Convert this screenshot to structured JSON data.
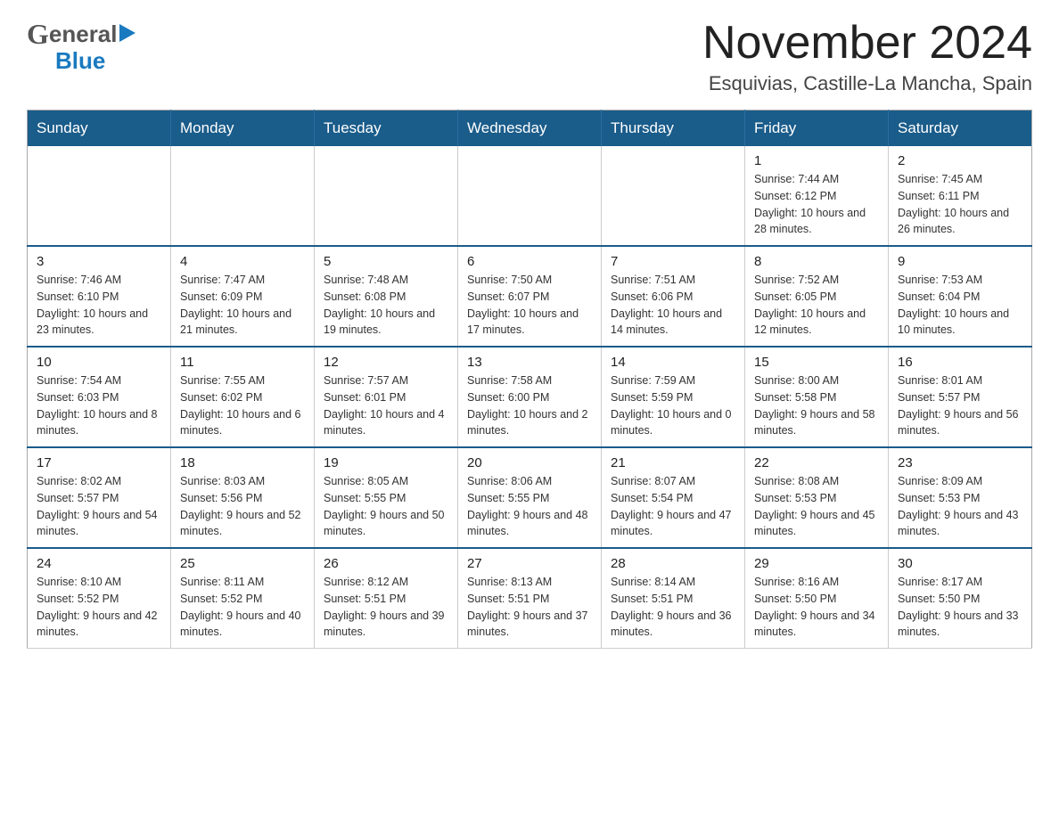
{
  "header": {
    "logo_general": "General",
    "logo_blue": "Blue",
    "month_title": "November 2024",
    "location": "Esquivias, Castille-La Mancha, Spain"
  },
  "days_of_week": [
    "Sunday",
    "Monday",
    "Tuesday",
    "Wednesday",
    "Thursday",
    "Friday",
    "Saturday"
  ],
  "weeks": [
    [
      {
        "day": "",
        "info": ""
      },
      {
        "day": "",
        "info": ""
      },
      {
        "day": "",
        "info": ""
      },
      {
        "day": "",
        "info": ""
      },
      {
        "day": "",
        "info": ""
      },
      {
        "day": "1",
        "info": "Sunrise: 7:44 AM\nSunset: 6:12 PM\nDaylight: 10 hours and 28 minutes."
      },
      {
        "day": "2",
        "info": "Sunrise: 7:45 AM\nSunset: 6:11 PM\nDaylight: 10 hours and 26 minutes."
      }
    ],
    [
      {
        "day": "3",
        "info": "Sunrise: 7:46 AM\nSunset: 6:10 PM\nDaylight: 10 hours and 23 minutes."
      },
      {
        "day": "4",
        "info": "Sunrise: 7:47 AM\nSunset: 6:09 PM\nDaylight: 10 hours and 21 minutes."
      },
      {
        "day": "5",
        "info": "Sunrise: 7:48 AM\nSunset: 6:08 PM\nDaylight: 10 hours and 19 minutes."
      },
      {
        "day": "6",
        "info": "Sunrise: 7:50 AM\nSunset: 6:07 PM\nDaylight: 10 hours and 17 minutes."
      },
      {
        "day": "7",
        "info": "Sunrise: 7:51 AM\nSunset: 6:06 PM\nDaylight: 10 hours and 14 minutes."
      },
      {
        "day": "8",
        "info": "Sunrise: 7:52 AM\nSunset: 6:05 PM\nDaylight: 10 hours and 12 minutes."
      },
      {
        "day": "9",
        "info": "Sunrise: 7:53 AM\nSunset: 6:04 PM\nDaylight: 10 hours and 10 minutes."
      }
    ],
    [
      {
        "day": "10",
        "info": "Sunrise: 7:54 AM\nSunset: 6:03 PM\nDaylight: 10 hours and 8 minutes."
      },
      {
        "day": "11",
        "info": "Sunrise: 7:55 AM\nSunset: 6:02 PM\nDaylight: 10 hours and 6 minutes."
      },
      {
        "day": "12",
        "info": "Sunrise: 7:57 AM\nSunset: 6:01 PM\nDaylight: 10 hours and 4 minutes."
      },
      {
        "day": "13",
        "info": "Sunrise: 7:58 AM\nSunset: 6:00 PM\nDaylight: 10 hours and 2 minutes."
      },
      {
        "day": "14",
        "info": "Sunrise: 7:59 AM\nSunset: 5:59 PM\nDaylight: 10 hours and 0 minutes."
      },
      {
        "day": "15",
        "info": "Sunrise: 8:00 AM\nSunset: 5:58 PM\nDaylight: 9 hours and 58 minutes."
      },
      {
        "day": "16",
        "info": "Sunrise: 8:01 AM\nSunset: 5:57 PM\nDaylight: 9 hours and 56 minutes."
      }
    ],
    [
      {
        "day": "17",
        "info": "Sunrise: 8:02 AM\nSunset: 5:57 PM\nDaylight: 9 hours and 54 minutes."
      },
      {
        "day": "18",
        "info": "Sunrise: 8:03 AM\nSunset: 5:56 PM\nDaylight: 9 hours and 52 minutes."
      },
      {
        "day": "19",
        "info": "Sunrise: 8:05 AM\nSunset: 5:55 PM\nDaylight: 9 hours and 50 minutes."
      },
      {
        "day": "20",
        "info": "Sunrise: 8:06 AM\nSunset: 5:55 PM\nDaylight: 9 hours and 48 minutes."
      },
      {
        "day": "21",
        "info": "Sunrise: 8:07 AM\nSunset: 5:54 PM\nDaylight: 9 hours and 47 minutes."
      },
      {
        "day": "22",
        "info": "Sunrise: 8:08 AM\nSunset: 5:53 PM\nDaylight: 9 hours and 45 minutes."
      },
      {
        "day": "23",
        "info": "Sunrise: 8:09 AM\nSunset: 5:53 PM\nDaylight: 9 hours and 43 minutes."
      }
    ],
    [
      {
        "day": "24",
        "info": "Sunrise: 8:10 AM\nSunset: 5:52 PM\nDaylight: 9 hours and 42 minutes."
      },
      {
        "day": "25",
        "info": "Sunrise: 8:11 AM\nSunset: 5:52 PM\nDaylight: 9 hours and 40 minutes."
      },
      {
        "day": "26",
        "info": "Sunrise: 8:12 AM\nSunset: 5:51 PM\nDaylight: 9 hours and 39 minutes."
      },
      {
        "day": "27",
        "info": "Sunrise: 8:13 AM\nSunset: 5:51 PM\nDaylight: 9 hours and 37 minutes."
      },
      {
        "day": "28",
        "info": "Sunrise: 8:14 AM\nSunset: 5:51 PM\nDaylight: 9 hours and 36 minutes."
      },
      {
        "day": "29",
        "info": "Sunrise: 8:16 AM\nSunset: 5:50 PM\nDaylight: 9 hours and 34 minutes."
      },
      {
        "day": "30",
        "info": "Sunrise: 8:17 AM\nSunset: 5:50 PM\nDaylight: 9 hours and 33 minutes."
      }
    ]
  ]
}
